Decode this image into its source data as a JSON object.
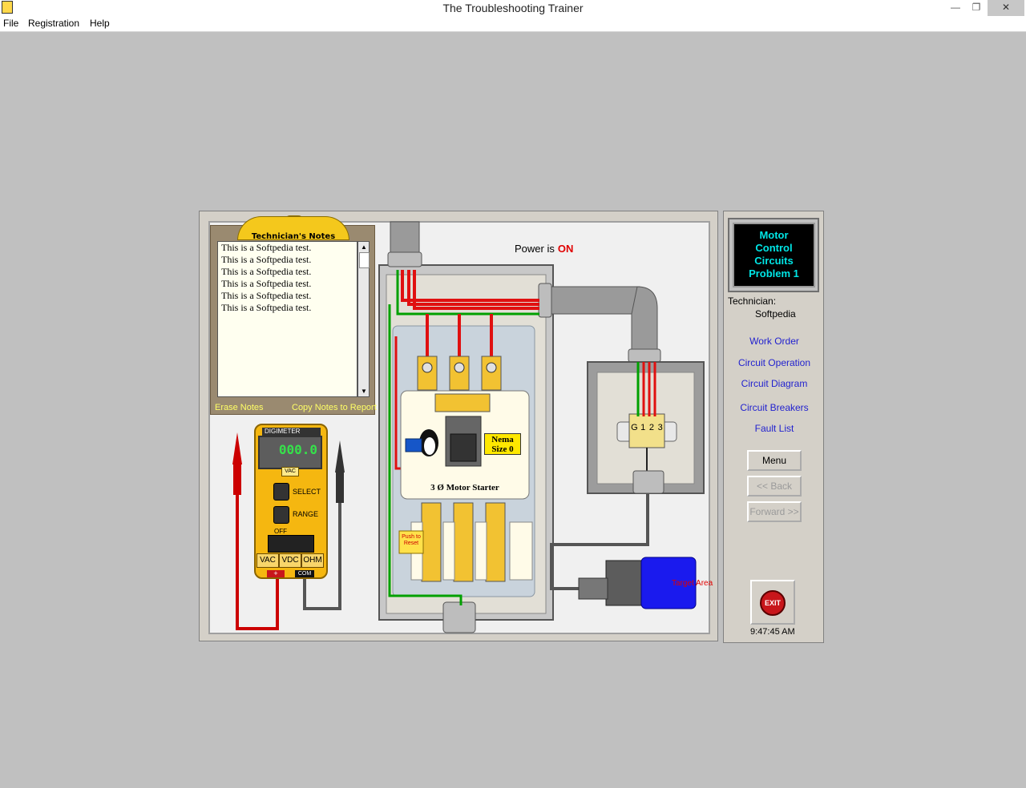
{
  "window": {
    "title": "The Troubleshooting Trainer",
    "minimize_glyph": "—",
    "maximize_glyph": "❐",
    "close_glyph": "✕"
  },
  "menu": [
    "File",
    "Registration",
    "Help"
  ],
  "notes": {
    "title": "Technician's Notes",
    "lines": [
      "This is a Softpedia test.",
      "This is a Softpedia test.",
      "This is a Softpedia test.",
      "This is a Softpedia test.",
      "This is a Softpedia test.",
      "This is a Softpedia test."
    ],
    "erase_label": "Erase Notes",
    "copy_label": "Copy Notes to Report"
  },
  "meter": {
    "brand": "DIGIMETER",
    "reading": "000.0",
    "mode_tag": "VAC",
    "select_label": "SELECT",
    "range_label": "RANGE",
    "off_label": "OFF",
    "modes": [
      "VAC",
      "VDC",
      "OHM"
    ],
    "plus_label": "+",
    "com_label": "COM"
  },
  "power": {
    "label": "Power is",
    "state": "ON"
  },
  "starter": {
    "nema_line1": "Nema",
    "nema_line2": "Size 0",
    "label": "3 Ø Motor Starter",
    "reset_line1": "Push to",
    "reset_line2": "Reset"
  },
  "junction_box": {
    "terminals": [
      "G",
      "1",
      "2",
      "3"
    ]
  },
  "motor": {
    "target_label": "Target Area"
  },
  "sidebar": {
    "problem_lines": [
      "Motor",
      "Control",
      "Circuits",
      "Problem 1"
    ],
    "technician_label": "Technician:",
    "technician_name": "Softpedia",
    "links": [
      "Work Order",
      "Circuit Operation",
      "Circuit Diagram",
      "Circuit Breakers",
      "Fault List"
    ],
    "menu_label": "Menu",
    "back_label": "<< Back",
    "forward_label": "Forward >>",
    "exit_label": "EXIT",
    "time": "9:47:45 AM"
  },
  "colors": {
    "background": "#c0c0c0",
    "power_on": "#e00000",
    "meter_body": "#f5b710",
    "meter_digits": "#36e04b",
    "problem_text": "#00e6e6",
    "link": "#1f1fcf",
    "notes_link": "#ffff66",
    "wire_red": "#e01010",
    "wire_green": "#00a000",
    "motor_blue": "#1a1aee"
  }
}
